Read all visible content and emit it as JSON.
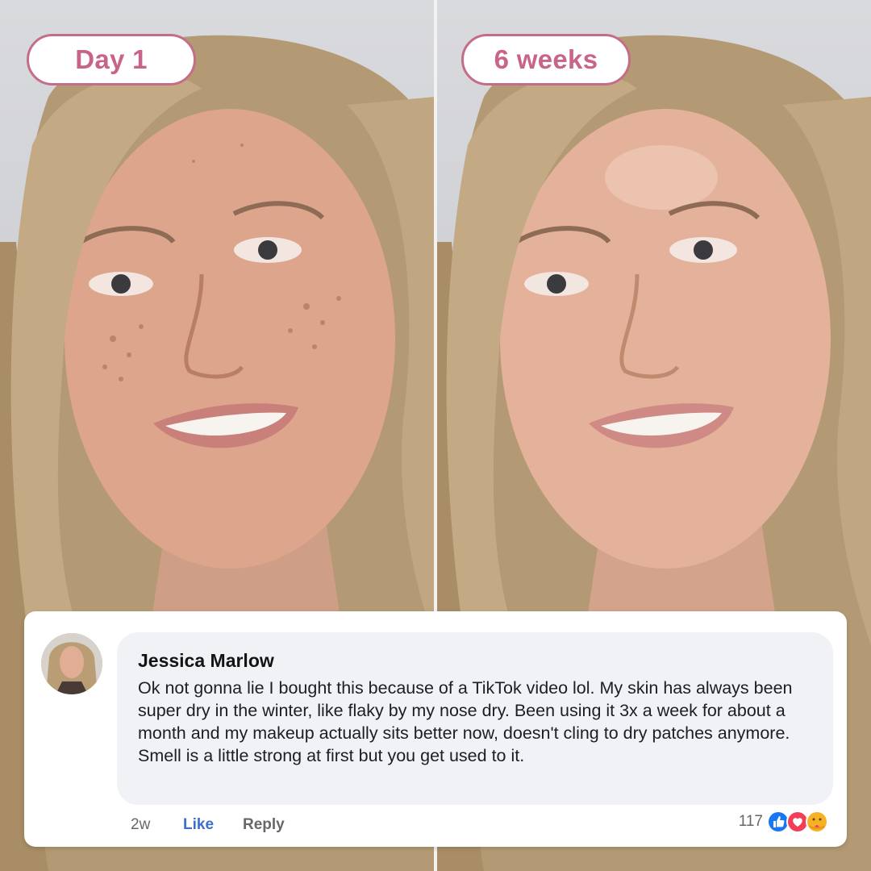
{
  "panels": {
    "before_label": "Day 1",
    "after_label": "6 weeks"
  },
  "comment": {
    "author": "Jessica Marlow",
    "text": "Ok not gonna lie I bought this because of a TikTok video lol. My skin has always been super dry in the winter, like flaky by my nose dry. Been using it 3x a week for about a month and my makeup actually sits better now, doesn't cling to dry patches anymore. Smell is a little strong at first but you get used to it.",
    "time": "2w",
    "like_label": "Like",
    "reply_label": "Reply",
    "reaction_count": "117",
    "reactions": [
      "like-reaction-icon",
      "love-reaction-icon",
      "care-reaction-icon"
    ]
  },
  "colors": {
    "pill_border": "#c46d89",
    "pill_text": "#c8648a",
    "like_blue": "#3b6fd0",
    "bubble_bg": "#f0f2f5"
  }
}
